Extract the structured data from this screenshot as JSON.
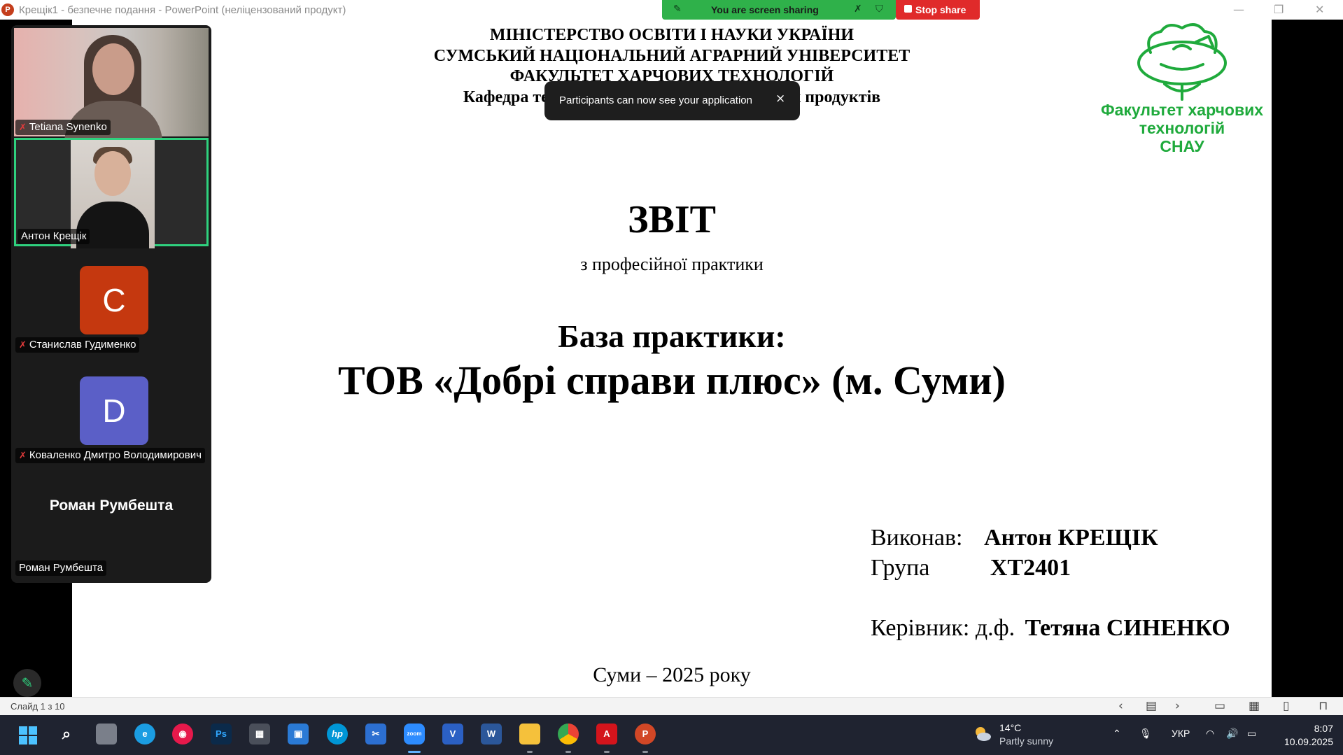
{
  "window": {
    "title": "Крещік1  -  безпечне подання - PowerPoint (неліцензований продукт)",
    "app_icon_letter": "P"
  },
  "share_bar": {
    "status": "You are screen sharing",
    "stop_label": "Stop share"
  },
  "toast": {
    "message": "Participants can now see your application",
    "close": "×"
  },
  "slide": {
    "header": [
      "МІНІСТЕРСТВО ОСВІТИ І НАУКИ УКРАЇНИ",
      "СУМСЬКИЙ НАЦІОНАЛЬНИЙ АГРАРНИЙ УНІВЕРСИТЕТ",
      "ФАКУЛЬТЕТ ХАРЧОВИХ ТЕХНОЛОГІЙ",
      "Кафедра технологій та безпечності харчових продуктів"
    ],
    "logo_text": [
      "Факультет харчових",
      "технологій",
      "СНАУ"
    ],
    "title": "ЗВІТ",
    "subtitle": "з професійної практики",
    "base_label": "База практики:",
    "organization": "ТОВ «Добрі справи плюс» (м. Суми)",
    "performer_label": "Виконав:",
    "performer_name": "Антон КРЕЩІК",
    "group_label": "Група",
    "group_value": "ХТ2401",
    "supervisor_label": "Керівник: д.ф.",
    "supervisor_name": "Тетяна СИНЕНКО",
    "city_year": "Суми – 2025 року"
  },
  "participants": [
    {
      "name": "Tetiana Synenko",
      "muted": true,
      "type": "video"
    },
    {
      "name": "Антон Крещік",
      "muted": false,
      "type": "video",
      "active_speaker": true
    },
    {
      "name": "Станислав Гудименко",
      "muted": true,
      "type": "avatar",
      "initial": "C",
      "color": "#c5380f"
    },
    {
      "name": "Коваленко Дмитро Володимирович",
      "muted": true,
      "type": "avatar",
      "initial": "D",
      "color": "#5b5fc7"
    },
    {
      "name": "Роман Румбешта",
      "display_name": "Роман Румбешта",
      "muted": false,
      "type": "name"
    }
  ],
  "status_bar": {
    "slide_counter": "Слайд 1 з 10"
  },
  "taskbar": {
    "weather_temp": "14°C",
    "weather_cond": "Partly sunny",
    "language": "УКР",
    "time": "8:07",
    "date": "10.09.2025"
  },
  "colors": {
    "share_green": "#2fb14a",
    "stop_red": "#e02a2a",
    "logo_green": "#1faa3c",
    "active_speaker": "#2fd17e",
    "taskbar": "#1f2330"
  }
}
